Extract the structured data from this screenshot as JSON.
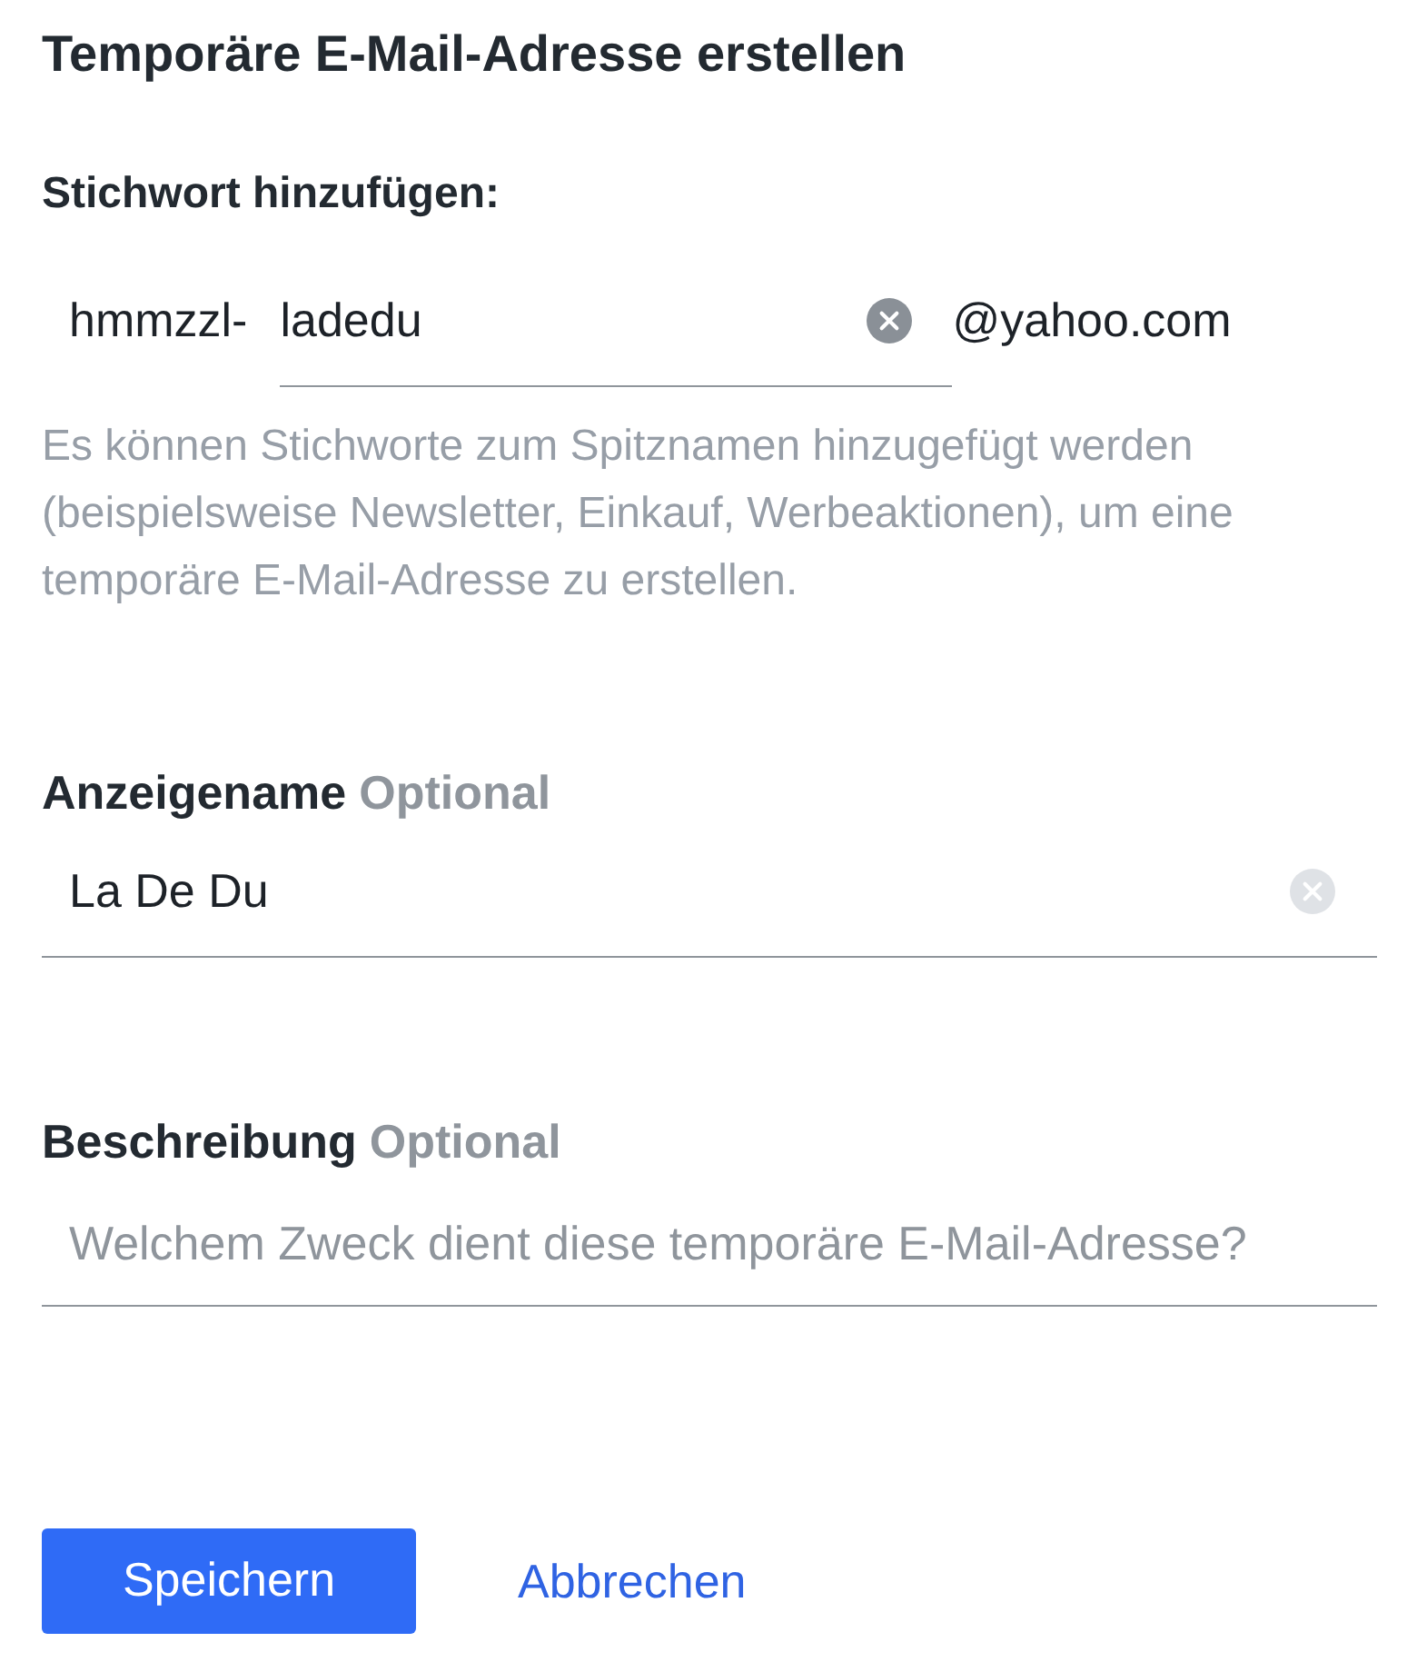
{
  "title": "Temporäre E-Mail-Adresse erstellen",
  "keyword": {
    "label": "Stichwort hinzufügen:",
    "prefix": "hmmzzl-",
    "value": "ladedu",
    "focused": true,
    "suffix": "@yahoo.com",
    "help": "Es können Stichworte zum Spitznamen hinzugefügt werden (beispielsweise Newsletter, Einkauf, Werbeaktionen), um eine temporäre E-Mail-Adresse zu erstellen."
  },
  "display_name": {
    "label": "Anzeigename",
    "hint": "Optional",
    "value": "La De Du",
    "focused": false
  },
  "description": {
    "label": "Beschreibung",
    "hint": "Optional",
    "placeholder": "Welchem Zweck dient diese temporäre E-Mail-Adresse?"
  },
  "buttons": [
    {
      "label": "Speichern",
      "kind": "primary"
    },
    {
      "label": "Abbrechen",
      "kind": "link"
    }
  ]
}
